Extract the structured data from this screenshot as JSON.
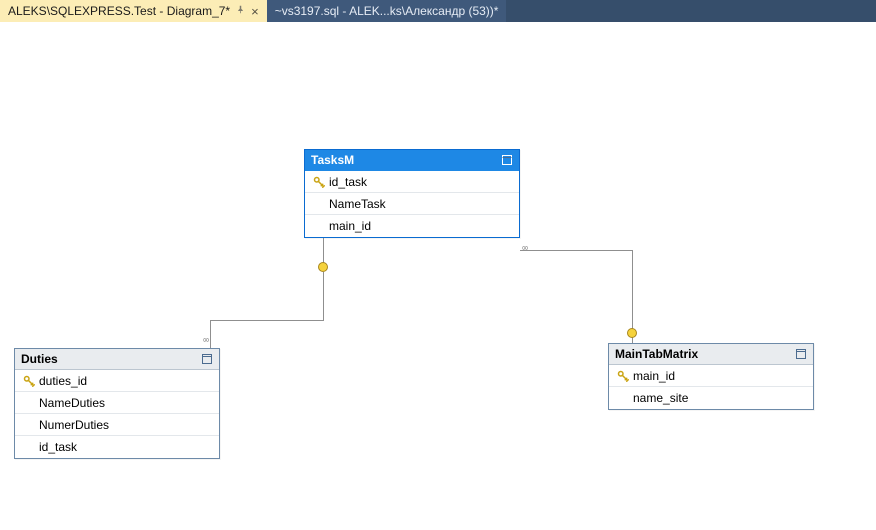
{
  "tabs": {
    "active": {
      "label": "ALEKS\\SQLEXPRESS.Test - Diagram_7*"
    },
    "inactive": {
      "label": "~vs3197.sql - ALEK...ks\\Александр (53))*"
    }
  },
  "tables": {
    "tasksm": {
      "title": "TasksM",
      "columns": [
        {
          "name": "id_task",
          "is_key": true
        },
        {
          "name": "NameTask",
          "is_key": false
        },
        {
          "name": "main_id",
          "is_key": false
        }
      ]
    },
    "duties": {
      "title": "Duties",
      "columns": [
        {
          "name": "duties_id",
          "is_key": true
        },
        {
          "name": "NameDuties",
          "is_key": false
        },
        {
          "name": "NumerDuties",
          "is_key": false
        },
        {
          "name": "id_task",
          "is_key": false
        }
      ]
    },
    "maintabmatrix": {
      "title": "MainTabMatrix",
      "columns": [
        {
          "name": "main_id",
          "is_key": true
        },
        {
          "name": "name_site",
          "is_key": false
        }
      ]
    }
  },
  "relations": [
    {
      "from": "tasksm.id_task",
      "to": "duties.id_task",
      "type": "one-to-many"
    },
    {
      "from": "tasksm.main_id",
      "to": "maintabmatrix.main_id",
      "type": "many-to-one"
    }
  ]
}
